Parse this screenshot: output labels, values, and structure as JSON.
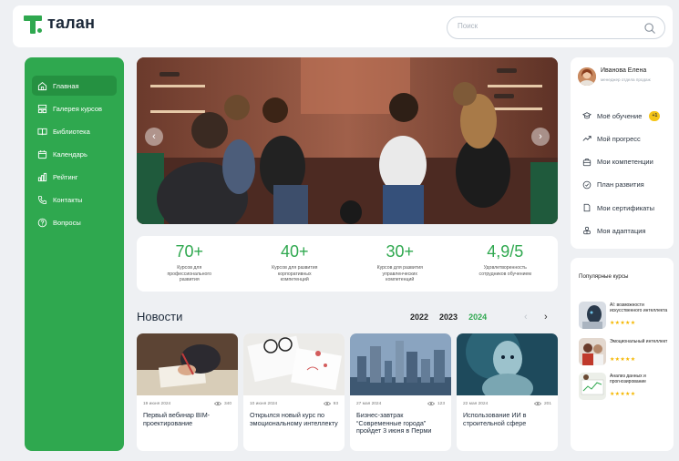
{
  "header": {
    "logo_text": "талан",
    "search_placeholder": "Поиск"
  },
  "sidebar": {
    "items": [
      {
        "label": "Главная",
        "icon": "home-icon",
        "active": true
      },
      {
        "label": "Галерея курсов",
        "icon": "gallery-icon",
        "active": false
      },
      {
        "label": "Библиотека",
        "icon": "book-icon",
        "active": false
      },
      {
        "label": "Календарь",
        "icon": "calendar-icon",
        "active": false
      },
      {
        "label": "Рейтинг",
        "icon": "rating-icon",
        "active": false
      },
      {
        "label": "Контакты",
        "icon": "phone-icon",
        "active": false
      },
      {
        "label": "Вопросы",
        "icon": "question-icon",
        "active": false
      }
    ]
  },
  "stats": [
    {
      "value": "70+",
      "description": "Курсов для профессионального развития"
    },
    {
      "value": "40+",
      "description": "Курсов для развития корпоративных компетенций"
    },
    {
      "value": "30+",
      "description": "Курсов для развития управленческих компетенций"
    },
    {
      "value": "4,9/5",
      "description": "Удовлетворенность сотрудников обучением"
    }
  ],
  "news": {
    "title": "Новости",
    "years": [
      "2022",
      "2023",
      "2024"
    ],
    "active_year": "2024",
    "cards": [
      {
        "date": "19 июня 2024",
        "views": "340",
        "title": "Первый вебинар BIM-проектирование"
      },
      {
        "date": "10 июня 2024",
        "views": "93",
        "title": "Открылся новый курс по эмоциональному интеллекту"
      },
      {
        "date": "27 мая 2024",
        "views": "123",
        "title": "Бизнес-завтрак “Современные города” пройдет 3 июня в Перми"
      },
      {
        "date": "22 мая 2024",
        "views": "201",
        "title": "Использование ИИ в строительной сфере"
      }
    ]
  },
  "profile": {
    "name": "Иванова Елена",
    "role": "менеджер отдела продаж",
    "menu": [
      {
        "label": "Моё обучение",
        "icon": "graduation-cap-icon",
        "badge": "+1"
      },
      {
        "label": "Мой прогресс",
        "icon": "trend-up-icon",
        "badge": ""
      },
      {
        "label": "Мои компетенции",
        "icon": "briefcase-icon",
        "badge": ""
      },
      {
        "label": "План развития",
        "icon": "target-icon",
        "badge": ""
      },
      {
        "label": "Мои сертификаты",
        "icon": "document-icon",
        "badge": ""
      },
      {
        "label": "Моя адаптация",
        "icon": "users-icon",
        "badge": ""
      }
    ]
  },
  "popular": {
    "title": "Популярные курсы",
    "courses": [
      {
        "name": "AI: возможности искусственного интеллекта",
        "stars": "★★★★★",
        "rating": 5
      },
      {
        "name": "Эмоциональный интеллект",
        "stars": "★★★★★",
        "rating": 5
      },
      {
        "name": "Анализ данных и прогнозирование",
        "stars": "★★★★★",
        "rating": 5
      }
    ]
  },
  "colors": {
    "brand_green": "#2fa84f",
    "active_nav": "#259141",
    "badge_yellow": "#f5c517",
    "star": "#f5b700"
  }
}
